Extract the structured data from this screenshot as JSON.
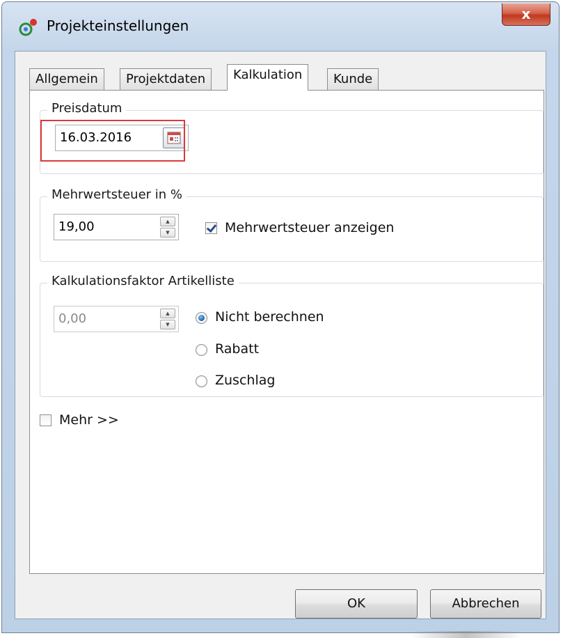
{
  "window": {
    "title": "Projekteinstellungen",
    "close_label": "x",
    "app_icon": "app-logo-icon"
  },
  "tabs": [
    {
      "label": "Allgemein",
      "active": false
    },
    {
      "label": "Projektdaten",
      "active": false
    },
    {
      "label": "Kalkulation",
      "active": true
    },
    {
      "label": "Kunde",
      "active": false
    }
  ],
  "preisdatum": {
    "legend": "Preisdatum",
    "value": "16.03.2016",
    "calendar_icon": "calendar-icon"
  },
  "mwst": {
    "legend": "Mehrwertsteuer in %",
    "value": "19,00",
    "checkbox_label": "Mehrwertsteuer anzeigen",
    "checkbox_checked": true
  },
  "kalkfaktor": {
    "legend": "Kalkulationsfaktor Artikelliste",
    "value": "0,00",
    "options": [
      {
        "label": "Nicht berechnen",
        "checked": true
      },
      {
        "label": "Rabatt",
        "checked": false
      },
      {
        "label": "Zuschlag",
        "checked": false
      }
    ]
  },
  "mehr": {
    "label": "Mehr >>",
    "checked": false
  },
  "buttons": {
    "ok": "OK",
    "cancel": "Abbrechen"
  },
  "colors": {
    "highlight": "#d93a3a",
    "close_button": "#c0391f",
    "radio_dot": "#1e5ea8"
  }
}
